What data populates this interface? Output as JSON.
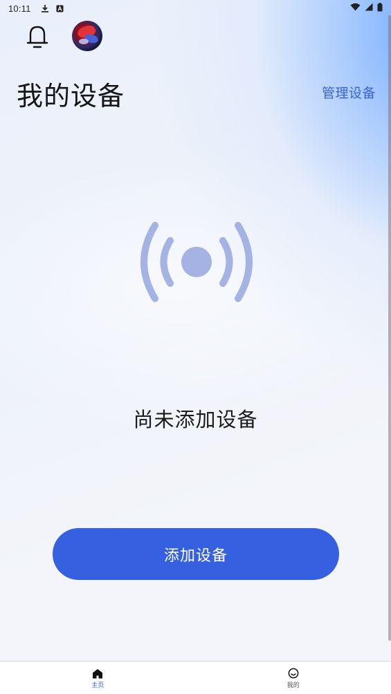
{
  "status_bar": {
    "time": "10:11"
  },
  "header": {
    "title": "我的设备",
    "manage_label": "管理设备"
  },
  "empty_state": {
    "message": "尚未添加设备"
  },
  "actions": {
    "add_device_label": "添加设备"
  },
  "bottom_nav": {
    "items": [
      {
        "label": "主页",
        "icon": "home-icon",
        "active": true
      },
      {
        "label": "我的",
        "icon": "smiley-icon",
        "active": false
      }
    ]
  },
  "colors": {
    "accent": "#3560df",
    "link": "#3a63d6",
    "signal_icon": "#a4b3e3",
    "title_text": "#151515"
  }
}
